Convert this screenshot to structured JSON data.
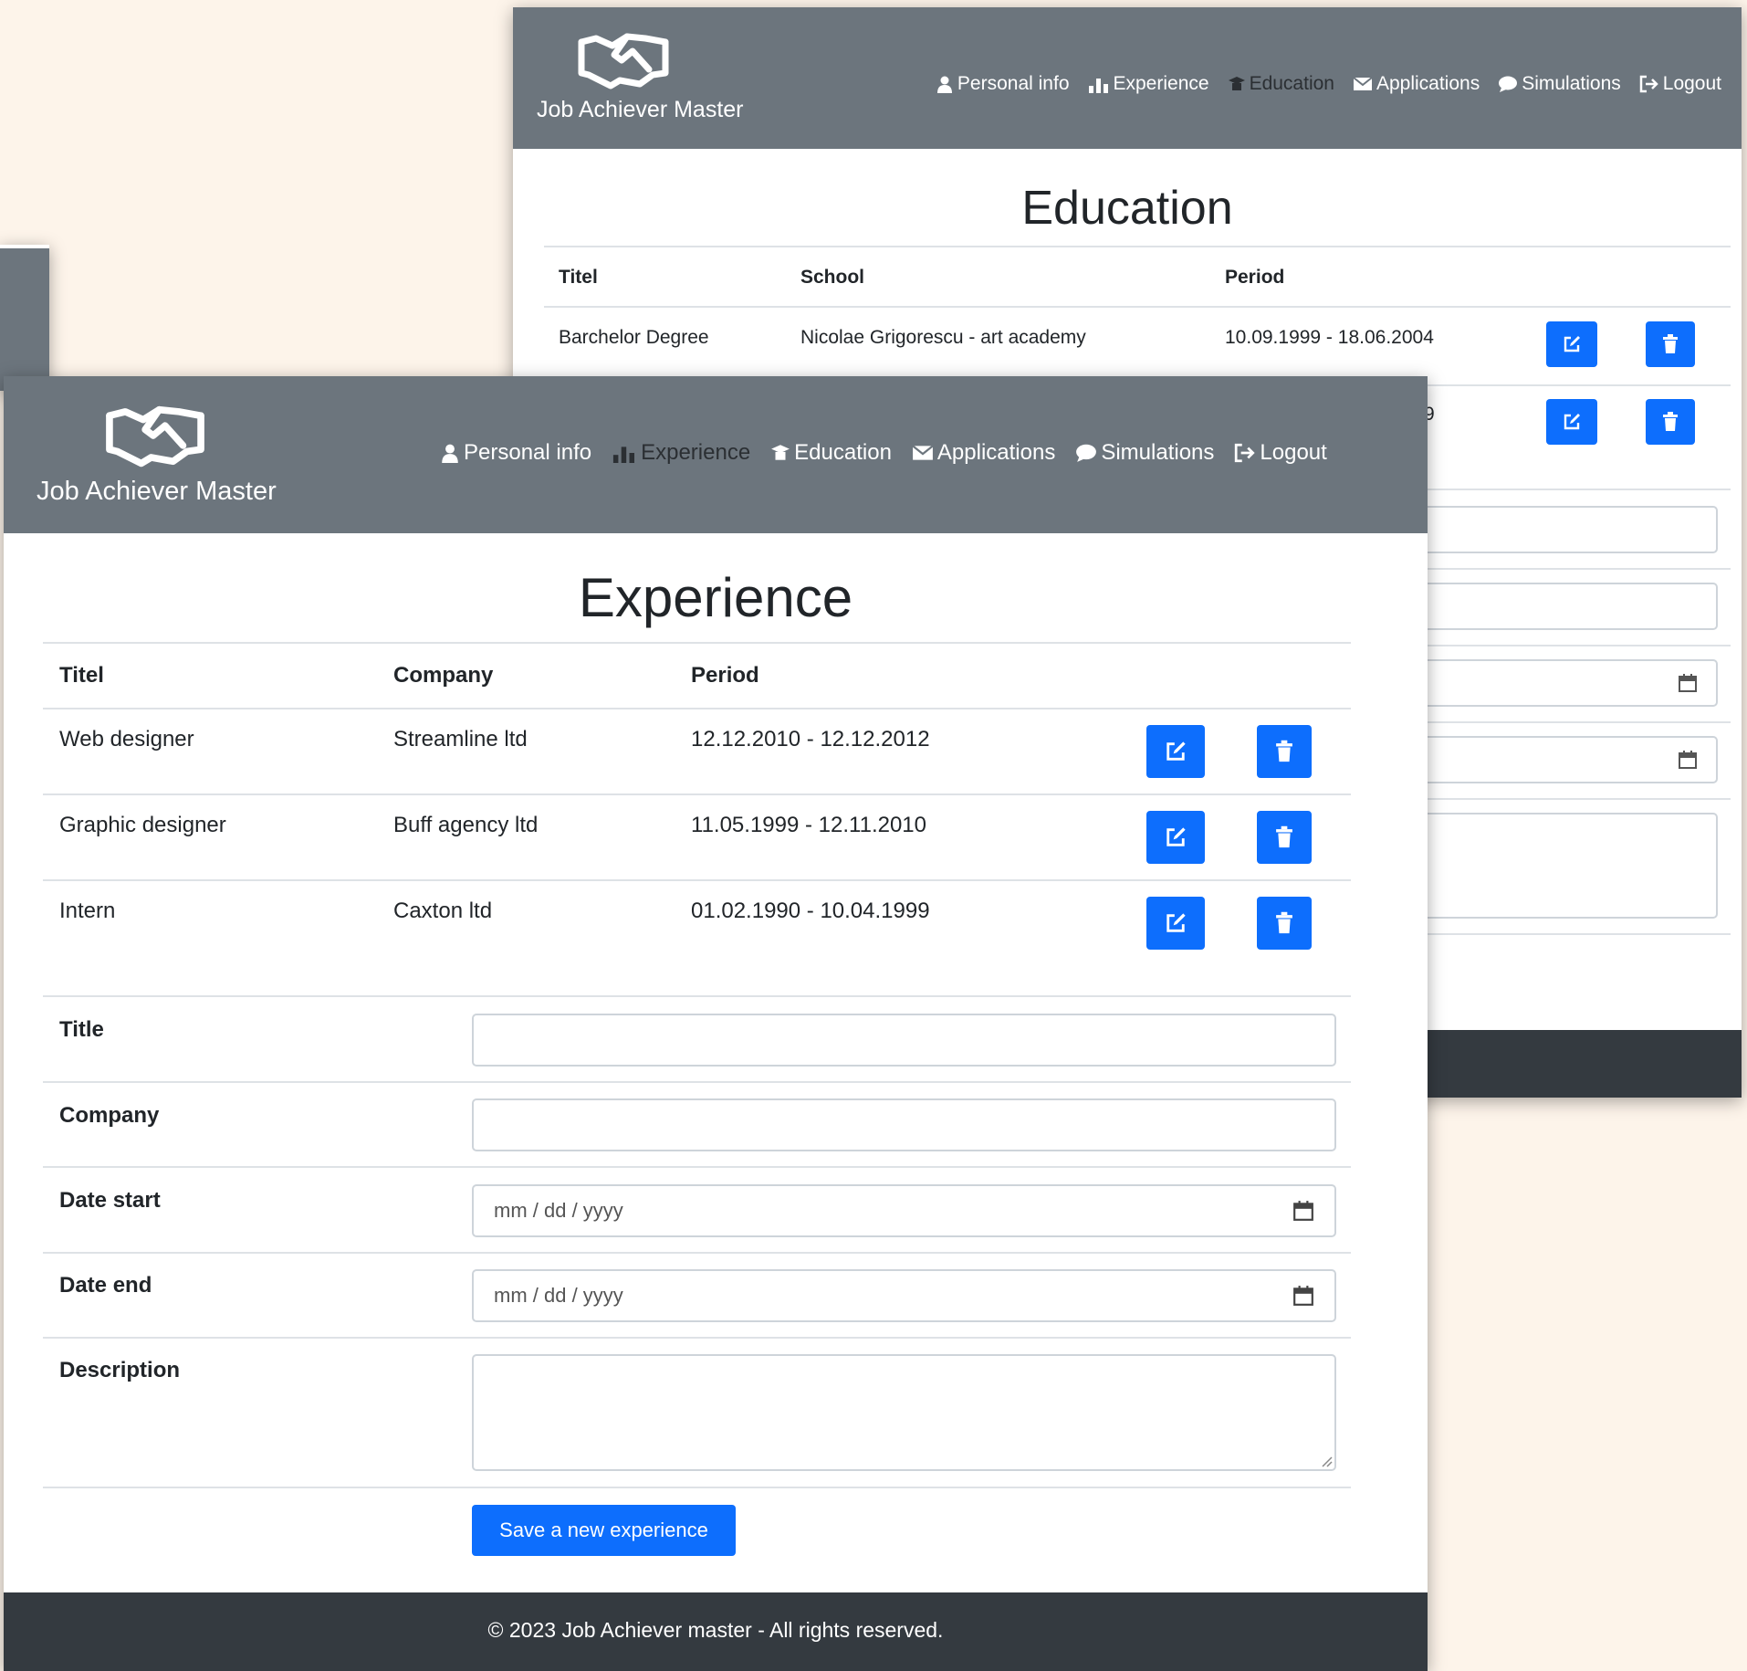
{
  "app": {
    "brand_name": "Job Achiever Master"
  },
  "nav": {
    "personal_info": "Personal info",
    "experience": "Experience",
    "education": "Education",
    "applications": "Applications",
    "simulations": "Simulations",
    "logout": "Logout"
  },
  "education_page": {
    "title": "Education",
    "headers": {
      "titel": "Titel",
      "school": "School",
      "period": "Period"
    },
    "rows": [
      {
        "titel": "Barchelor Degree",
        "school": "Nicolae Grigorescu - art academy",
        "period": "10.09.1999 - 18.06.2004"
      },
      {
        "period_fragment": "9"
      }
    ]
  },
  "experience_page": {
    "title": "Experience",
    "headers": {
      "titel": "Titel",
      "company": "Company",
      "period": "Period"
    },
    "rows": [
      {
        "titel": "Web designer",
        "company": "Streamline ltd",
        "period": "12.12.2010 - 12.12.2012"
      },
      {
        "titel": "Graphic designer",
        "company": "Buff agency ltd",
        "period": "11.05.1999 - 12.11.2010"
      },
      {
        "titel": "Intern",
        "company": "Caxton ltd",
        "period": "01.02.1990 - 10.04.1999"
      }
    ],
    "form": {
      "title_label": "Title",
      "title_value": "",
      "company_label": "Company",
      "company_value": "",
      "date_start_label": "Date start",
      "date_start_placeholder": "mm / dd / yyyy",
      "date_end_label": "Date end",
      "date_end_placeholder": "mm / dd / yyyy",
      "description_label": "Description",
      "description_value": "",
      "save_label": "Save a new experience"
    }
  },
  "footer": {
    "text": "© 2023 Job Achiever master - All rights reserved."
  },
  "colors": {
    "navbar": "#6c757d",
    "primary": "#0d6efd",
    "footer": "#343a40",
    "background": "#fdf4ea"
  },
  "icons": [
    "handshake-icon",
    "user-icon",
    "chart-icon",
    "graduation-icon",
    "envelope-icon",
    "chat-icon",
    "logout-icon",
    "edit-icon",
    "trash-icon",
    "calendar-icon"
  ]
}
